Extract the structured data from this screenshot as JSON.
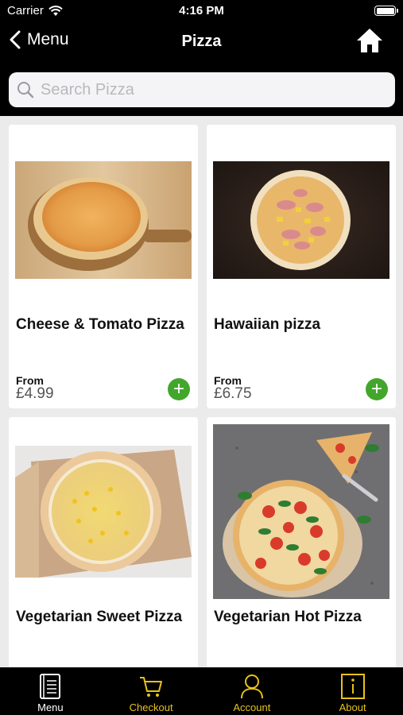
{
  "status_bar": {
    "carrier": "Carrier",
    "time": "4:16 PM"
  },
  "nav": {
    "back_label": "Menu",
    "title": "Pizza",
    "home_icon": "home-icon"
  },
  "search": {
    "placeholder": "Search Pizza",
    "value": ""
  },
  "products": [
    {
      "name": "Cheese & Tomato Pizza",
      "from_label": "From",
      "price": "£4.99",
      "image": "cheese-tomato-pizza-photo"
    },
    {
      "name": "Hawaiian pizza",
      "from_label": "From",
      "price": "£6.75",
      "image": "hawaiian-pizza-photo"
    },
    {
      "name": "Vegetarian Sweet Pizza",
      "image": "sweetcorn-pizza-photo"
    },
    {
      "name": "Vegetarian Hot Pizza",
      "image": "hot-pizza-photo"
    }
  ],
  "tabs": [
    {
      "label": "Menu",
      "icon": "menu-book-icon",
      "active": true
    },
    {
      "label": "Checkout",
      "icon": "cart-icon",
      "active": false
    },
    {
      "label": "Account",
      "icon": "user-icon",
      "active": false
    },
    {
      "label": "About",
      "icon": "info-icon",
      "active": false
    }
  ],
  "colors": {
    "accent_gold": "#e8c21a",
    "add_green": "#43a62c",
    "background": "#000000",
    "content_bg": "#ebebeb"
  }
}
